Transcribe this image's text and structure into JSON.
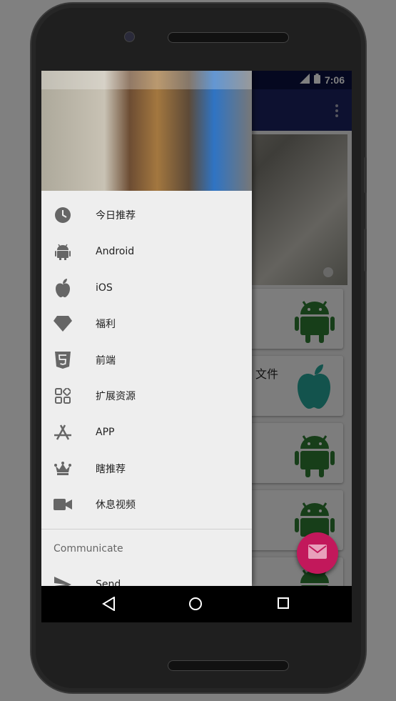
{
  "status_bar": {
    "time": "7:06"
  },
  "background": {
    "cards": [
      {
        "title": ""
      },
      {
        "title": "文件"
      },
      {
        "title": ""
      },
      {
        "title": ""
      },
      {
        "title": ""
      }
    ]
  },
  "drawer": {
    "menu": [
      {
        "label": "今日推荐",
        "icon": "clock-icon"
      },
      {
        "label": "Android",
        "icon": "android-icon"
      },
      {
        "label": "iOS",
        "icon": "apple-icon"
      },
      {
        "label": "福利",
        "icon": "diamond-icon"
      },
      {
        "label": "前端",
        "icon": "html5-icon"
      },
      {
        "label": "扩展资源",
        "icon": "apps-icon"
      },
      {
        "label": "APP",
        "icon": "app-store-icon"
      },
      {
        "label": "瞎推荐",
        "icon": "crown-icon"
      },
      {
        "label": "休息视频",
        "icon": "video-icon"
      }
    ],
    "section_title": "Communicate",
    "send_label": "Send"
  },
  "colors": {
    "toolbar": "#1a2261",
    "statusbar": "#0a1040",
    "fab": "#c2185b",
    "android_green": "#2e7d32",
    "apple_teal": "#26a69a",
    "drawer_bg": "#eeeeee"
  }
}
